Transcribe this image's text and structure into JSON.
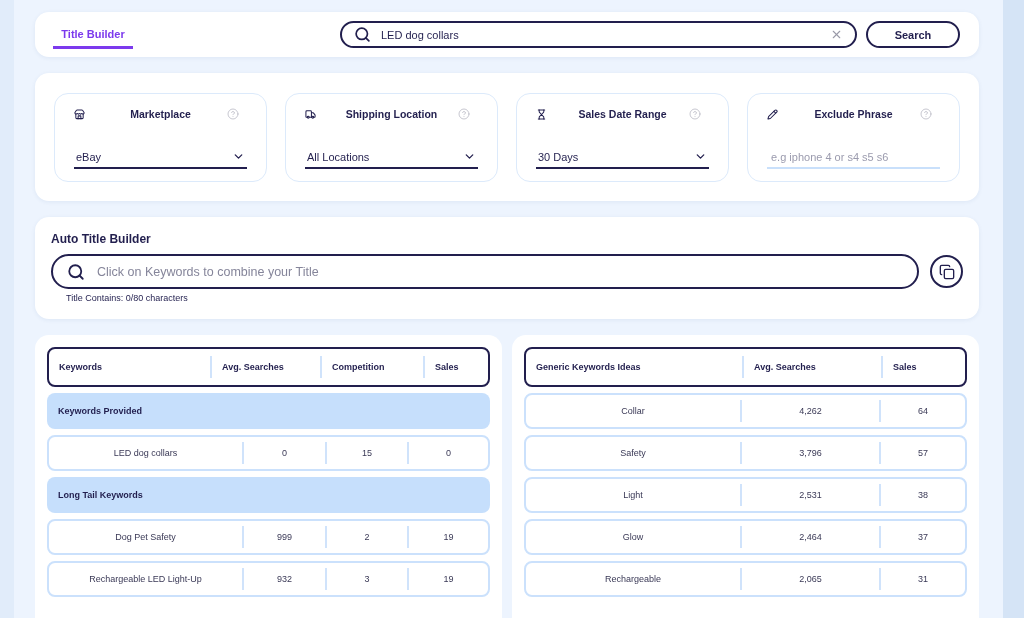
{
  "tabs": [
    {
      "label": "Title Builder",
      "selected": true
    }
  ],
  "search": {
    "value": "LED dog collars",
    "button": "Search"
  },
  "filters": [
    {
      "kind": "select",
      "label": "Marketplace",
      "value": "eBay"
    },
    {
      "kind": "select",
      "label": "Shipping Location",
      "value": "All Locations"
    },
    {
      "kind": "select",
      "label": "Sales Date Range",
      "value": "30 Days"
    },
    {
      "kind": "input",
      "label": "Exclude Phrase",
      "placeholder": "e.g iphone 4 or s4 s5 s6"
    }
  ],
  "auto_title_builder": {
    "title": "Auto Title Builder",
    "placeholder": "Click on Keywords to combine your Title",
    "counter": "Title Contains: 0/80 characters"
  },
  "keywords_table": {
    "columns": [
      "Keywords",
      "Avg. Searches",
      "Competition",
      "Sales"
    ],
    "rows": [
      {
        "kind": "group",
        "label": "Keywords Provided"
      },
      {
        "kind": "data",
        "cells": [
          "LED dog collars",
          "0",
          "15",
          "0"
        ]
      },
      {
        "kind": "group",
        "label": "Long Tail Keywords"
      },
      {
        "kind": "data",
        "cells": [
          "Dog Pet Safety",
          "999",
          "2",
          "19"
        ]
      },
      {
        "kind": "data",
        "cells": [
          "Rechargeable LED Light-Up",
          "932",
          "3",
          "19"
        ]
      }
    ]
  },
  "generic_table": {
    "columns": [
      "Generic Keywords Ideas",
      "Avg. Searches",
      "Sales"
    ],
    "rows": [
      {
        "cells": [
          "Collar",
          "4,262",
          "64"
        ]
      },
      {
        "cells": [
          "Safety",
          "3,796",
          "57"
        ]
      },
      {
        "cells": [
          "Light",
          "2,531",
          "38"
        ]
      },
      {
        "cells": [
          "Glow",
          "2,464",
          "37"
        ]
      },
      {
        "cells": [
          "Rechargeable",
          "2,065",
          "31"
        ]
      }
    ]
  }
}
